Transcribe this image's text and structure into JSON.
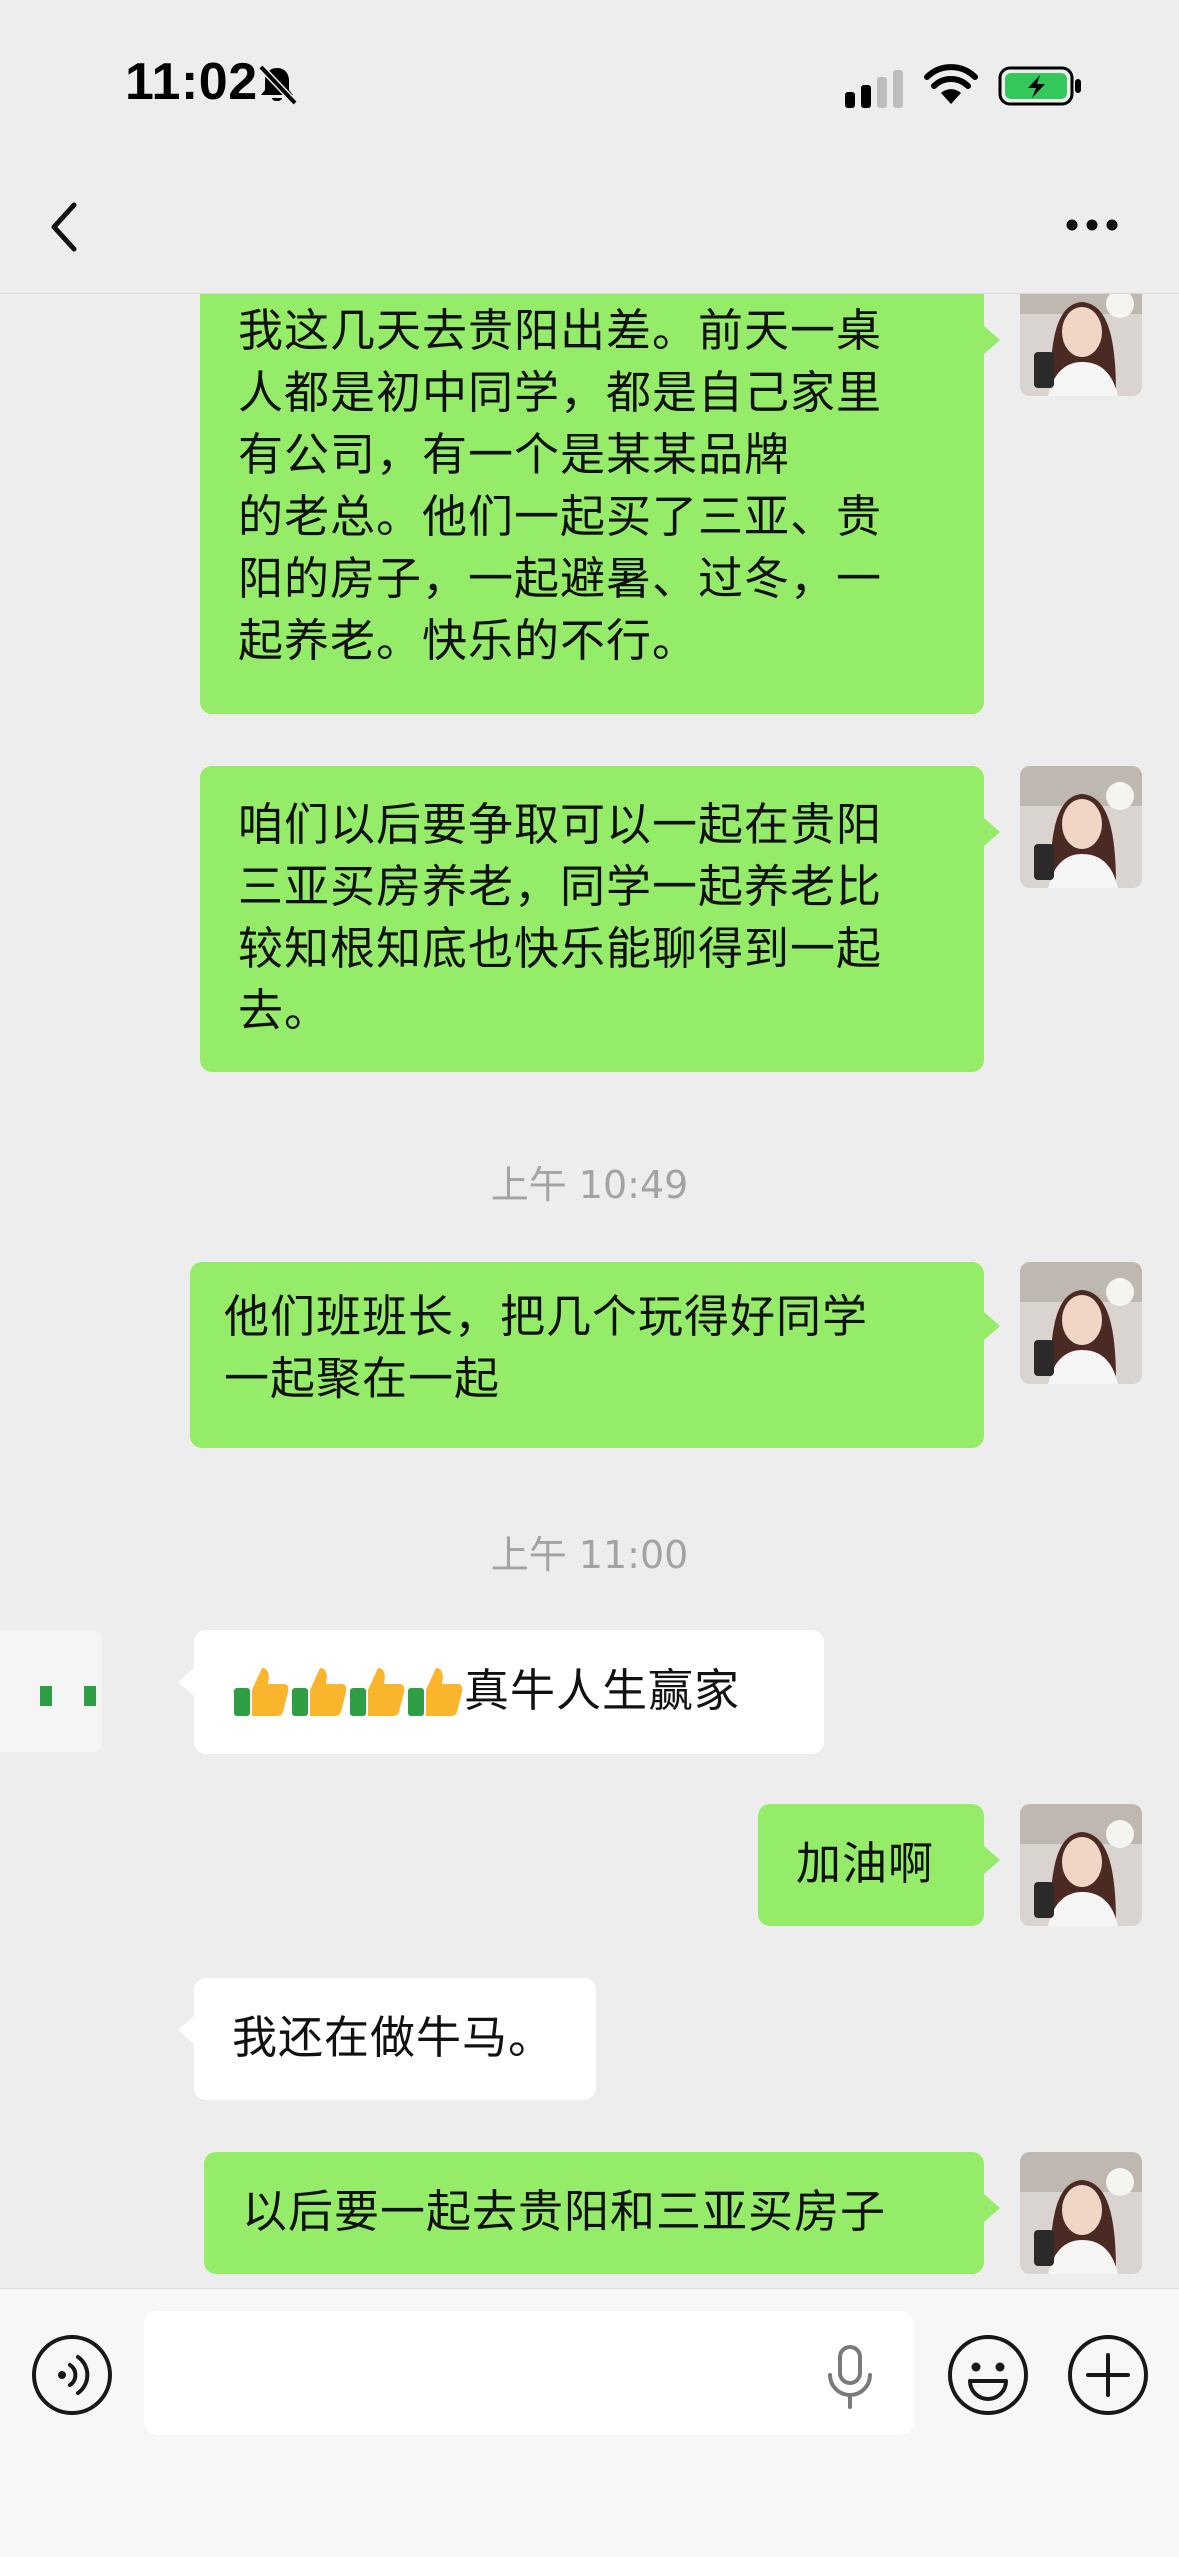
{
  "status_bar": {
    "time": "11:02",
    "icons": [
      "bell-off-icon",
      "cellular-signal-icon",
      "wifi-icon",
      "battery-charging-icon"
    ],
    "battery_color": "#34c759"
  },
  "nav_bar": {
    "back_icon": "chevron-left-icon",
    "more_icon": "more-dots-icon"
  },
  "colors": {
    "sent_bubble": "#95ec69",
    "received_bubble": "#ffffff",
    "background": "#ededed",
    "timestamp_text": "#a3a3a3"
  },
  "messages": [
    {
      "side": "sent",
      "lines": [
        "我这几天去贵阳出差。前天一桌",
        "人都是初中同学，都是自己家里",
        "有公司，有一个是某某品牌",
        "的老总。他们一起买了三亚、贵",
        "阳的房子，一起避暑、过冬，一",
        "起养老。快乐的不行。"
      ]
    },
    {
      "side": "sent",
      "lines": [
        "咱们以后要争取可以一起在贵阳",
        "三亚买房养老，同学一起养老比",
        "较知根知底也快乐能聊得到一起",
        "去。"
      ]
    },
    {
      "timestamp": "上午 10:49"
    },
    {
      "side": "sent",
      "lines": [
        " 他们班班长，把几个玩得好同学",
        "一起聚在一起"
      ]
    },
    {
      "timestamp": "上午 11:00"
    },
    {
      "side": "received",
      "emoji": [
        "👍",
        "👍",
        "👍",
        "👍"
      ],
      "text": "真牛人生赢家"
    },
    {
      "side": "sent",
      "text": "加油啊"
    },
    {
      "side": "received",
      "text": "我还在做牛马。"
    },
    {
      "side": "sent",
      "text": "以后要一起去贵阳和三亚买房子"
    }
  ],
  "input_bar": {
    "voice_icon": "voice-input-icon",
    "mic_icon": "microphone-icon",
    "emoji_icon": "emoji-icon",
    "plus_icon": "plus-icon",
    "value": "",
    "placeholder": ""
  }
}
